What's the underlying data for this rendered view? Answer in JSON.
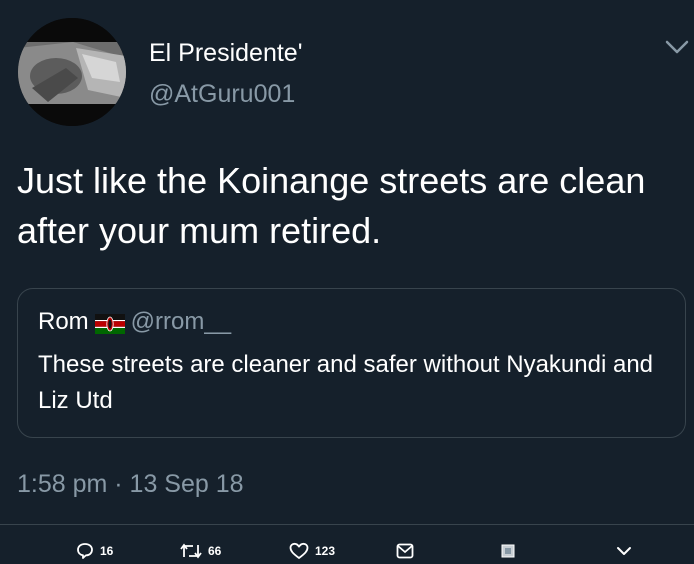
{
  "tweet": {
    "author": {
      "display_name": "El Presidente'",
      "handle": "@AtGuru001"
    },
    "text": "Just like the Koinange streets are clean after your mum retired.",
    "timestamp": "1:58 pm · 13 Sep 18"
  },
  "quoted_tweet": {
    "author_name": "Rom",
    "author_handle": "@rrom__",
    "flag_icon": "kenya-flag-icon",
    "text": "These streets are cleaner and safer without Nyakundi and Liz Utd"
  },
  "actions": {
    "reply_count": "16",
    "retweet_count": "66",
    "like_count": "123"
  },
  "colors": {
    "background": "#15202b",
    "secondary_text": "#8899a6",
    "border": "#38444d",
    "primary_text": "#ffffff"
  },
  "icons": [
    "chevron-down-icon",
    "reply-icon",
    "retweet-icon",
    "like-icon",
    "dm-icon",
    "image-icon"
  ]
}
